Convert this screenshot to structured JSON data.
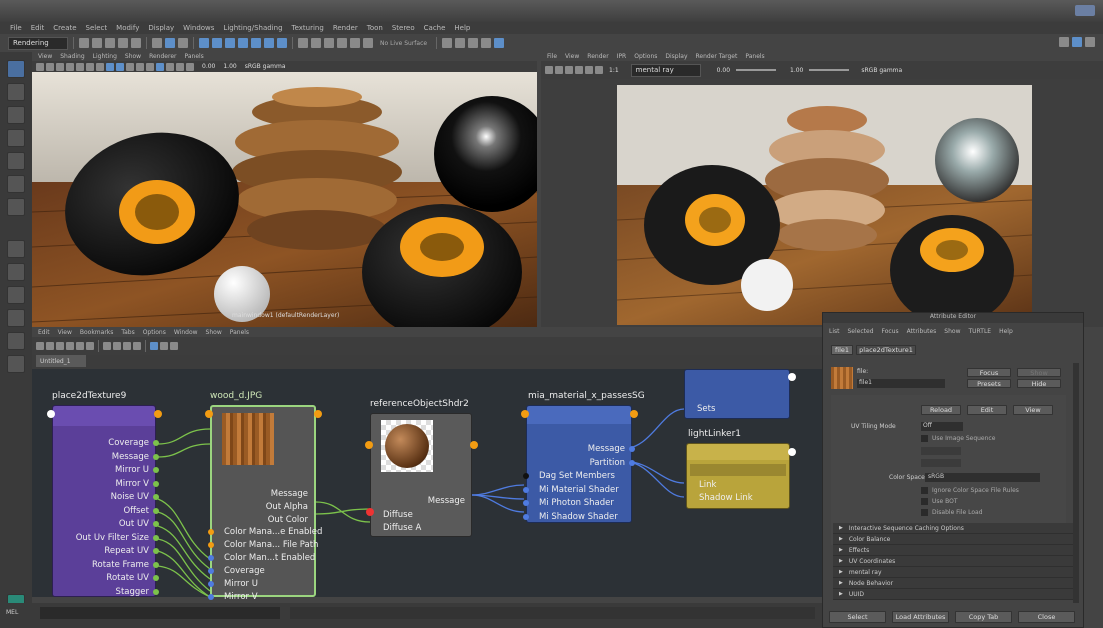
{
  "menubar": [
    "File",
    "Edit",
    "Create",
    "Select",
    "Modify",
    "Display",
    "Windows",
    "Lighting/Shading",
    "Texturing",
    "Render",
    "Toon",
    "Stereo",
    "Cache",
    "Help"
  ],
  "shelf": {
    "mode": "Rendering",
    "no_live_surface": "No Live Surface"
  },
  "viewport_left": {
    "menu": [
      "View",
      "Shading",
      "Lighting",
      "Show",
      "Renderer",
      "Panels"
    ],
    "exposure": "0.00",
    "gamma": "1.00",
    "color_space": "sRGB gamma",
    "caption": "mainwindow1 (defaultRenderLayer)"
  },
  "render_view": {
    "menu": [
      "File",
      "View",
      "Render",
      "IPR",
      "Options",
      "Display",
      "Render Target",
      "Panels"
    ],
    "renderer": "mental ray",
    "exposure": "0.00",
    "gamma": "1.00",
    "color_space": "sRGB gamma",
    "ratio": "1:1"
  },
  "hypershade": {
    "menu": [
      "Edit",
      "View",
      "Bookmarks",
      "Tabs",
      "Options",
      "Window",
      "Show",
      "Panels"
    ],
    "tab": "Untitled_1"
  },
  "nodes": {
    "place2d": {
      "title": "place2dTexture9",
      "attrs": [
        "Coverage",
        "Message",
        "Mirror U",
        "Mirror V",
        "Noise UV",
        "Offset",
        "Out UV",
        "Out Uv Filter Size",
        "Repeat UV",
        "Rotate Frame",
        "Rotate UV",
        "Stagger"
      ]
    },
    "wood": {
      "title": "wood_d.JPG",
      "outputs": [
        "Message",
        "Out Alpha",
        "Out Color"
      ],
      "inputs": [
        "Color Mana...e Enabled",
        "Color Mana... File Path",
        "Color Man...t Enabled",
        "Coverage",
        "Mirror U",
        "Mirror V"
      ]
    },
    "reference": {
      "title": "referenceObjectShdr2",
      "out": "Message",
      "inputs": [
        "Diffuse",
        "Diffuse A"
      ]
    },
    "mia": {
      "title": "mia_material_x_passesSG",
      "attrs": [
        "Message",
        "Partition",
        "Dag Set Members",
        "Mi Material Shader",
        "Mi Photon Shader",
        "Mi Shadow Shader"
      ]
    },
    "sets": {
      "label": "Sets"
    },
    "lightlinker": {
      "title": "lightLinker1",
      "attrs": [
        "Link",
        "Shadow Link"
      ]
    }
  },
  "attr_editor": {
    "title": "Attribute Editor",
    "menu": [
      "List",
      "Selected",
      "Focus",
      "Attributes",
      "Show",
      "TURTLE",
      "Help"
    ],
    "tabs": [
      "file1",
      "place2dTexture1"
    ],
    "file_label": "file:",
    "file_value": "file1",
    "buttons_side": [
      "Focus",
      "Presets",
      "Show",
      "Hide"
    ],
    "reload": "Reload",
    "edit": "Edit",
    "view": "View",
    "uv_tiling_label": "UV Tiling Mode",
    "uv_tiling_value": "Off",
    "use_image_sequence": "Use Image Sequence",
    "color_space_label": "Color Space",
    "color_space_value": "sRGB",
    "ignore_cs": "Ignore Color Space File Rules",
    "use_bot": "Use BOT",
    "disable_file_load": "Disable File Load",
    "sections": [
      "Interactive Sequence Caching Options",
      "Color Balance",
      "Effects",
      "UV Coordinates",
      "mental ray",
      "Node Behavior",
      "UUID"
    ],
    "bottom": [
      "Select",
      "Load Attributes",
      "Copy Tab",
      "Close"
    ]
  },
  "status": {
    "label": "MEL"
  },
  "colors": {
    "purple": "#5b3f99",
    "purple_head": "#6a4db0",
    "blue_node": "#3c5aa6",
    "yellow_node": "#b9a43b",
    "wood_border": "#9bd57f",
    "port_orange": "#f39c12",
    "port_green": "#7cc24b",
    "port_blue": "#4f7be0"
  }
}
